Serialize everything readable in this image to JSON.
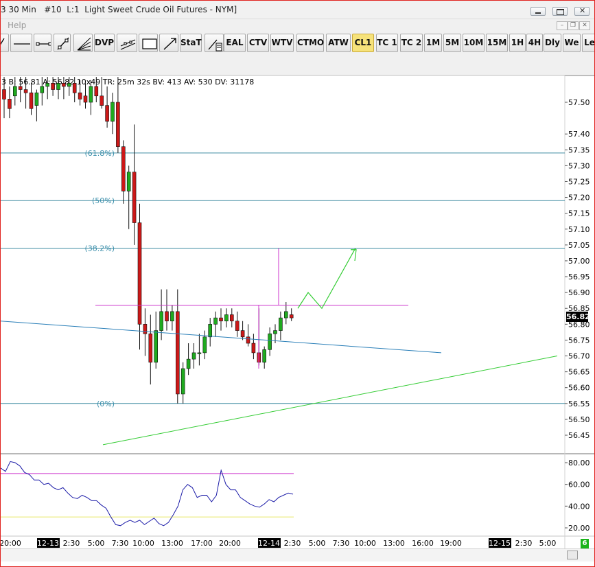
{
  "window": {
    "title": "3 30 Min   #10  L:1  Light Sweet Crude Oil Futures - NYM]",
    "menu": [
      "Help"
    ]
  },
  "toolbar": {
    "buttons": [
      {
        "label": "",
        "icon": "partial-tool-icon",
        "active": false
      },
      {
        "label": "",
        "icon": "horizontal-line-icon",
        "active": false
      },
      {
        "label": "",
        "icon": "horizontal-segment-icon",
        "active": false
      },
      {
        "label": "",
        "icon": "trendline-points-icon",
        "active": false
      },
      {
        "label": "",
        "icon": "fibonacci-fan-icon",
        "active": false
      },
      {
        "label": "DVP",
        "icon": "",
        "active": false
      },
      {
        "label": "",
        "icon": "channel-icon",
        "active": false
      },
      {
        "label": "",
        "icon": "rectangle-icon",
        "active": false
      },
      {
        "label": "",
        "icon": "arrow-icon",
        "active": false
      },
      {
        "label": "StaT",
        "icon": "",
        "active": false
      },
      {
        "label": "",
        "icon": "pencil-tool-icon",
        "active": false
      },
      {
        "label": "EAL",
        "icon": "",
        "active": false
      },
      {
        "label": "CTV",
        "icon": "",
        "active": false
      },
      {
        "label": "WTV",
        "icon": "",
        "active": false
      },
      {
        "label": "CTMO",
        "icon": "",
        "active": false
      },
      {
        "label": "ATW",
        "icon": "",
        "active": false
      },
      {
        "label": "CL1",
        "icon": "",
        "active": true
      },
      {
        "label": "TC 1",
        "icon": "",
        "active": false
      },
      {
        "label": "TC 2",
        "icon": "",
        "active": false
      },
      {
        "label": "1M",
        "icon": "",
        "active": false
      },
      {
        "label": "5M",
        "icon": "",
        "active": false
      },
      {
        "label": "10M",
        "icon": "",
        "active": false
      },
      {
        "label": "15M",
        "icon": "",
        "active": false
      },
      {
        "label": "1H",
        "icon": "",
        "active": false
      },
      {
        "label": "4H",
        "icon": "",
        "active": false
      },
      {
        "label": "Dly",
        "icon": "",
        "active": false
      },
      {
        "label": "We",
        "icon": "",
        "active": false
      },
      {
        "label": "Le",
        "icon": "",
        "active": false
      }
    ]
  },
  "info": {
    "text": "3 B: 56.81  A: 56.82  10x49  TR: 25m 32s  BV: 413  AV: 530  DV: 31178"
  },
  "price_label": "56.82",
  "scroll_badge": "6",
  "chart_data": {
    "type": "candlestick",
    "y_axis": {
      "ticks": [
        "57.50",
        "57.40",
        "57.35",
        "57.30",
        "57.25",
        "57.20",
        "57.15",
        "57.10",
        "57.05",
        "57.00",
        "56.95",
        "56.90",
        "56.85",
        "56.80",
        "56.75",
        "56.70",
        "56.65",
        "56.60",
        "56.55",
        "56.50",
        "56.45"
      ],
      "range": [
        56.4,
        57.56
      ]
    },
    "x_axis": {
      "ticks": [
        "20:00",
        "12-13",
        "2:30",
        "5:00",
        "7:30",
        "10:00",
        "13:00",
        "17:00",
        "20:00",
        "12-14",
        "2:30",
        "5:00",
        "7:30",
        "10:00",
        "13:00",
        "16:00",
        "19:00",
        "12-15",
        "2:30",
        "5:00"
      ],
      "highlighted": [
        "12-13",
        "12-14",
        "12-15"
      ]
    },
    "fib_levels": [
      {
        "label": "(61.8%)",
        "price": 57.34
      },
      {
        "label": "(50%)",
        "price": 57.19
      },
      {
        "label": "(38.2%)",
        "price": 57.04
      },
      {
        "label": "(0%)",
        "price": 56.55
      }
    ],
    "candles": [
      {
        "o": 57.54,
        "h": 57.58,
        "l": 57.45,
        "c": 57.51
      },
      {
        "o": 57.51,
        "h": 57.55,
        "l": 57.45,
        "c": 57.48
      },
      {
        "o": 57.52,
        "h": 57.58,
        "l": 57.49,
        "c": 57.55
      },
      {
        "o": 57.55,
        "h": 57.58,
        "l": 57.5,
        "c": 57.54
      },
      {
        "o": 57.54,
        "h": 57.58,
        "l": 57.48,
        "c": 57.53
      },
      {
        "o": 57.53,
        "h": 57.56,
        "l": 57.46,
        "c": 57.48
      },
      {
        "o": 57.49,
        "h": 57.54,
        "l": 57.44,
        "c": 57.53
      },
      {
        "o": 57.53,
        "h": 57.58,
        "l": 57.49,
        "c": 57.55
      },
      {
        "o": 57.55,
        "h": 57.58,
        "l": 57.51,
        "c": 57.56
      },
      {
        "o": 57.56,
        "h": 57.58,
        "l": 57.52,
        "c": 57.54
      },
      {
        "o": 57.54,
        "h": 57.58,
        "l": 57.51,
        "c": 57.56
      },
      {
        "o": 57.56,
        "h": 57.58,
        "l": 57.51,
        "c": 57.55
      },
      {
        "o": 57.55,
        "h": 57.58,
        "l": 57.52,
        "c": 57.56
      },
      {
        "o": 57.56,
        "h": 57.58,
        "l": 57.5,
        "c": 57.53
      },
      {
        "o": 57.53,
        "h": 57.57,
        "l": 57.49,
        "c": 57.51
      },
      {
        "o": 57.52,
        "h": 57.56,
        "l": 57.48,
        "c": 57.5
      },
      {
        "o": 57.5,
        "h": 57.57,
        "l": 57.46,
        "c": 57.55
      },
      {
        "o": 57.55,
        "h": 57.58,
        "l": 57.5,
        "c": 57.52
      },
      {
        "o": 57.52,
        "h": 57.58,
        "l": 57.48,
        "c": 57.49
      },
      {
        "o": 57.49,
        "h": 57.55,
        "l": 57.42,
        "c": 57.44
      },
      {
        "o": 57.44,
        "h": 57.53,
        "l": 57.4,
        "c": 57.5
      },
      {
        "o": 57.5,
        "h": 57.58,
        "l": 57.34,
        "c": 57.36
      },
      {
        "o": 57.36,
        "h": 57.38,
        "l": 57.18,
        "c": 57.22
      },
      {
        "o": 57.22,
        "h": 57.3,
        "l": 57.1,
        "c": 57.28
      },
      {
        "o": 57.28,
        "h": 57.43,
        "l": 57.05,
        "c": 57.12
      },
      {
        "o": 57.12,
        "h": 57.18,
        "l": 56.72,
        "c": 56.8
      },
      {
        "o": 56.8,
        "h": 56.85,
        "l": 56.7,
        "c": 56.77
      },
      {
        "o": 56.77,
        "h": 56.83,
        "l": 56.61,
        "c": 56.68
      },
      {
        "o": 56.68,
        "h": 56.84,
        "l": 56.66,
        "c": 56.78
      },
      {
        "o": 56.78,
        "h": 56.91,
        "l": 56.75,
        "c": 56.84
      },
      {
        "o": 56.84,
        "h": 56.91,
        "l": 56.78,
        "c": 56.81
      },
      {
        "o": 56.81,
        "h": 56.86,
        "l": 56.78,
        "c": 56.84
      },
      {
        "o": 56.84,
        "h": 56.91,
        "l": 56.55,
        "c": 56.58
      },
      {
        "o": 56.58,
        "h": 56.68,
        "l": 56.55,
        "c": 56.66
      },
      {
        "o": 56.66,
        "h": 56.74,
        "l": 56.64,
        "c": 56.69
      },
      {
        "o": 56.69,
        "h": 56.74,
        "l": 56.66,
        "c": 56.71
      },
      {
        "o": 56.71,
        "h": 56.77,
        "l": 56.67,
        "c": 56.71
      },
      {
        "o": 56.71,
        "h": 56.78,
        "l": 56.69,
        "c": 56.76
      },
      {
        "o": 56.76,
        "h": 56.82,
        "l": 56.73,
        "c": 56.8
      },
      {
        "o": 56.8,
        "h": 56.84,
        "l": 56.76,
        "c": 56.82
      },
      {
        "o": 56.82,
        "h": 56.85,
        "l": 56.78,
        "c": 56.81
      },
      {
        "o": 56.81,
        "h": 56.85,
        "l": 56.79,
        "c": 56.83
      },
      {
        "o": 56.83,
        "h": 56.85,
        "l": 56.79,
        "c": 56.81
      },
      {
        "o": 56.81,
        "h": 56.84,
        "l": 56.76,
        "c": 56.78
      },
      {
        "o": 56.78,
        "h": 56.81,
        "l": 56.75,
        "c": 56.76
      },
      {
        "o": 56.76,
        "h": 56.8,
        "l": 56.73,
        "c": 56.74
      },
      {
        "o": 56.74,
        "h": 56.77,
        "l": 56.69,
        "c": 56.71
      },
      {
        "o": 56.71,
        "h": 56.85,
        "l": 56.67,
        "c": 56.68
      },
      {
        "o": 56.68,
        "h": 56.73,
        "l": 56.66,
        "c": 56.72
      },
      {
        "o": 56.72,
        "h": 56.79,
        "l": 56.7,
        "c": 56.77
      },
      {
        "o": 56.77,
        "h": 56.8,
        "l": 56.74,
        "c": 56.78
      },
      {
        "o": 56.78,
        "h": 56.84,
        "l": 56.75,
        "c": 56.82
      },
      {
        "o": 56.82,
        "h": 56.87,
        "l": 56.8,
        "c": 56.84
      },
      {
        "o": 56.83,
        "h": 56.85,
        "l": 56.81,
        "c": 56.82
      }
    ],
    "indicator": {
      "y_ticks": [
        "80.00",
        "60.00",
        "40.00",
        "20.00"
      ],
      "range": [
        15,
        88
      ],
      "upper_level": 70,
      "lower_level": 30,
      "values": [
        75,
        72,
        81,
        80,
        77,
        71,
        69,
        64,
        64,
        60,
        61,
        57,
        55,
        57,
        52,
        48,
        47,
        50,
        48,
        45,
        45,
        41,
        38,
        30,
        23,
        22,
        25,
        27,
        25,
        27,
        23,
        26,
        29,
        24,
        22,
        25,
        32,
        40,
        55,
        60,
        57,
        48,
        50,
        50,
        44,
        50,
        73,
        60,
        55,
        55,
        48,
        45,
        42,
        40,
        39,
        42,
        46,
        44,
        48,
        50,
        52,
        51
      ]
    }
  }
}
